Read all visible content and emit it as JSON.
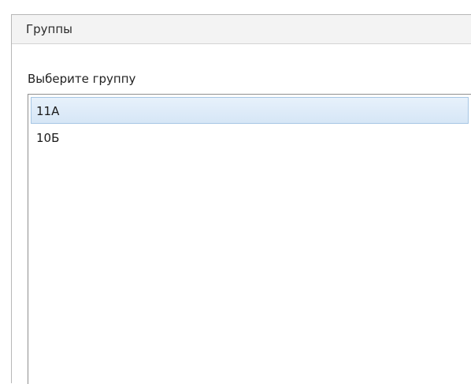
{
  "panel": {
    "title": "Группы"
  },
  "prompt": {
    "label": "Выберите группу"
  },
  "groups": {
    "items": [
      {
        "label": "11А",
        "selected": true
      },
      {
        "label": "10Б",
        "selected": false
      }
    ]
  },
  "colors": {
    "selection_fill": "#dde9f7",
    "selection_border": "#a6c6e4",
    "header_fill": "#f3f3f3"
  }
}
